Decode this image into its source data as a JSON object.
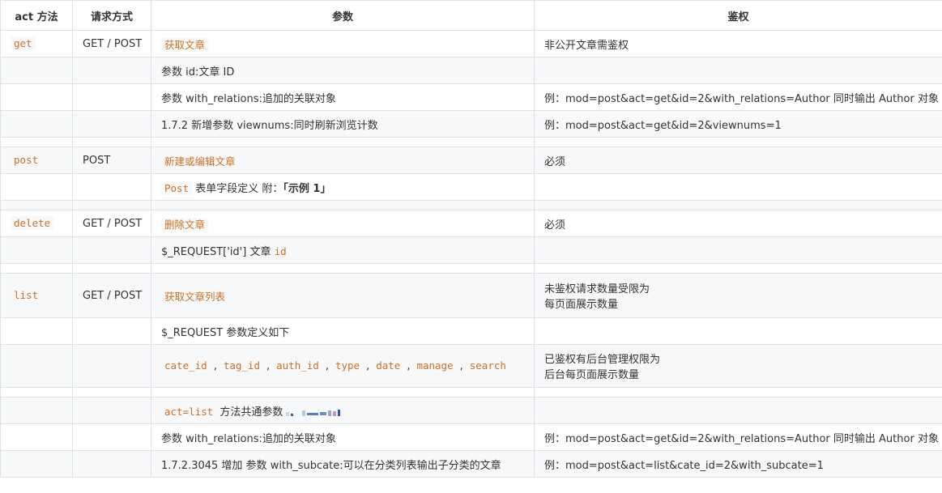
{
  "headers": [
    "act 方法",
    "请求方式",
    "参数",
    "鉴权"
  ],
  "rows": {
    "get": {
      "act": "get",
      "method": "GET / POST",
      "param_code": "获取文章",
      "auth": "非公开文章需鉴权",
      "sub1": "参数 id:文章 ID",
      "sub2": "参数 with_relations:追加的关联对象",
      "sub2_auth": "例：mod=post&act=get&id=2&with_relations=Author 同时输出 Author 对象",
      "sub3": "1.7.2 新增参数 viewnums:同时刷新浏览计数",
      "sub3_auth": "例：mod=post&act=get&id=2&viewnums=1"
    },
    "post": {
      "act": "post",
      "method": "POST",
      "param_code": "新建或编辑文章",
      "auth": "必须",
      "sub1_code": "Post",
      "sub1_text": " 表单字段定义 附：",
      "sub1_bold": "「示例 1」"
    },
    "delete": {
      "act": "delete",
      "method": "GET / POST",
      "param_code": "删除文章",
      "auth": "必须",
      "sub1_text": "$_REQUEST['id'] 文章 ",
      "sub1_code": "id"
    },
    "list": {
      "act": "list",
      "method": "GET / POST",
      "param_code": "获取文章列表",
      "auth_line1": "未鉴权请求数量受限为",
      "auth_line2": "每页面展示数量",
      "sub1": "$_REQUEST 参数定义如下",
      "sub2_codes": [
        "cate_id",
        "tag_id",
        "auth_id",
        "type",
        "date",
        "manage",
        "search"
      ],
      "sub2_sep": ",",
      "sub2_auth_line1": "已鉴权有后台管理权限为",
      "sub2_auth_line2": "后台每页面展示数量",
      "sub3_code": "act=list",
      "sub3_text": " 方法共通参数",
      "sub4": "参数 with_relations:追加的关联对象",
      "sub4_auth": "例：mod=post&act=get&id=2&with_relations=Author 同时输出 Author 对象",
      "sub5": "1.7.2.3045 增加 参数 with_subcate:可以在分类列表输出子分类的文章",
      "sub5_auth": "例：mod=post&act=list&cate_id=2&with_subcate=1"
    }
  }
}
